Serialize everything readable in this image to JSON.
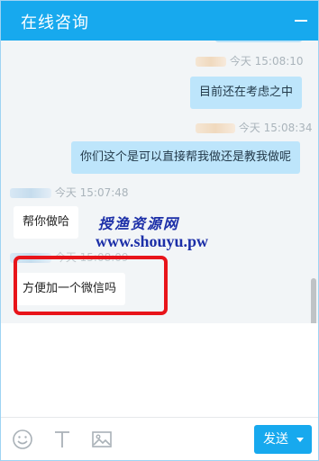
{
  "header": {
    "title": "在线咨询",
    "minimize_icon": "minimize-icon"
  },
  "messages": [
    {
      "side": "out",
      "time": "今天 15:08:10",
      "text": "目前还在考虑之中"
    },
    {
      "side": "out",
      "time": "今天 15:08:34",
      "text": "你们这个是可以直接帮我做还是教我做呢"
    },
    {
      "side": "in",
      "time": "今天 15:07:48",
      "text": "帮你做哈"
    },
    {
      "side": "in",
      "time": "今天 15:08:09",
      "text": "方便加一个微信吗"
    }
  ],
  "watermark": {
    "line1": "授渔资源网",
    "line2": "www.shouyu.pw"
  },
  "toolbar": {
    "emoji_icon": "emoji-icon",
    "text_icon": "text-format-icon",
    "image_icon": "image-icon",
    "send_label": "发送"
  },
  "colors": {
    "accent": "#17a9ee",
    "out_bubble": "#bde5fb",
    "highlight": "#e8141a"
  }
}
